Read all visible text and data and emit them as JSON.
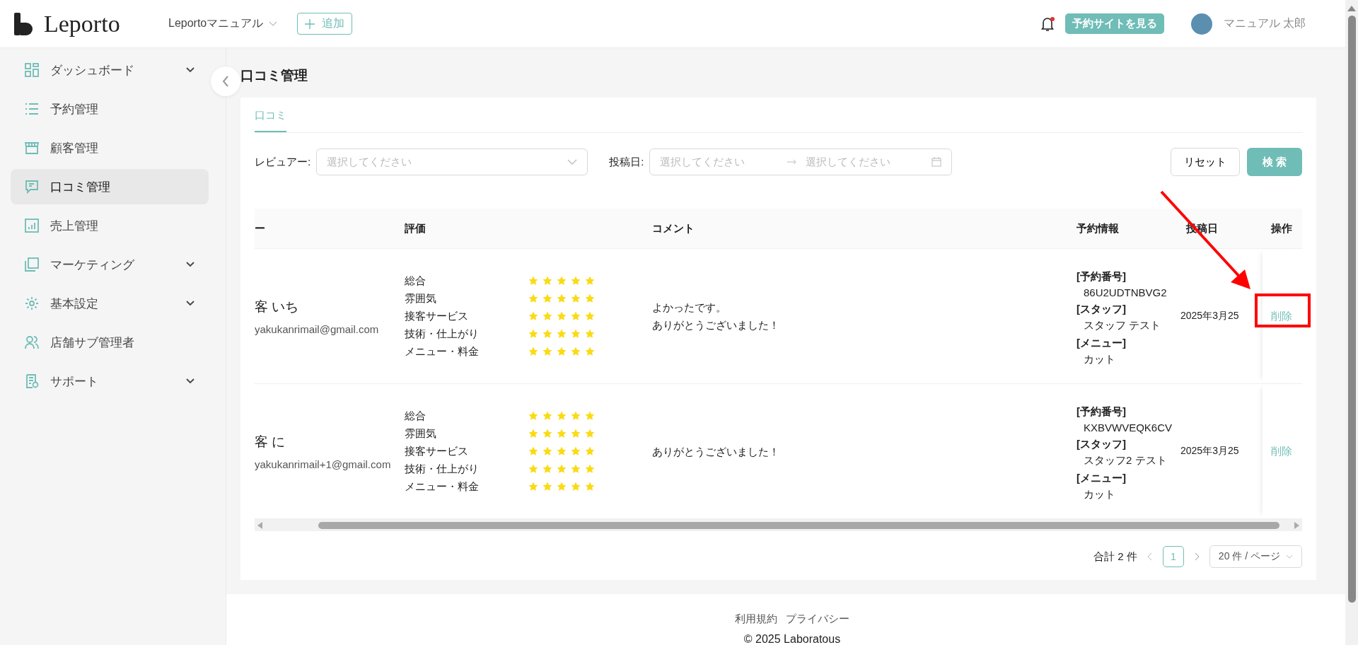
{
  "header": {
    "logo": "Leporto",
    "store_select": "Leportoマニュアル",
    "add_button": "追加",
    "has_notification": true,
    "site_button": "予約サイトを見る",
    "user_name": "マニュアル 太郎"
  },
  "sidebar": {
    "items": [
      {
        "label": "ダッシュボード",
        "expandable": true,
        "selected": false
      },
      {
        "label": "予約管理",
        "expandable": false,
        "selected": false
      },
      {
        "label": "顧客管理",
        "expandable": false,
        "selected": false
      },
      {
        "label": "口コミ管理",
        "expandable": false,
        "selected": true
      },
      {
        "label": "売上管理",
        "expandable": false,
        "selected": false
      },
      {
        "label": "マーケティング",
        "expandable": true,
        "selected": false
      },
      {
        "label": "基本設定",
        "expandable": true,
        "selected": false
      },
      {
        "label": "店舗サブ管理者",
        "expandable": false,
        "selected": false
      },
      {
        "label": "サポート",
        "expandable": true,
        "selected": false
      }
    ]
  },
  "page_title": "口コミ管理",
  "tabs": [
    {
      "label": "口コミ",
      "selected": true
    }
  ],
  "filters": {
    "reviewer_label": "レビュアー:",
    "reviewer_placeholder": "選択してください",
    "date_label": "投稿日:",
    "date_start_placeholder": "選択してください",
    "date_end_placeholder": "選択してください",
    "reset_button": "リセット",
    "search_button": "検 索"
  },
  "table": {
    "columns": [
      "ー",
      "評価",
      "コメント",
      "予約情報",
      "投稿日",
      "操作"
    ],
    "rows": [
      {
        "name": "客 いち",
        "email": "yakukanrimail@gmail.com",
        "ratings": [
          {
            "label": "総合",
            "stars": 5
          },
          {
            "label": "雰囲気",
            "stars": 5
          },
          {
            "label": "接客サービス",
            "stars": 5
          },
          {
            "label": "技術・仕上がり",
            "stars": 5
          },
          {
            "label": "メニュー・料金",
            "stars": 5
          }
        ],
        "comment": [
          "よかったです。",
          "ありがとうございました！"
        ],
        "reservation": [
          {
            "label": "[予約番号]",
            "value": "86U2UDTNBVG2"
          },
          {
            "label": "[スタッフ]",
            "value": "スタッフ テスト"
          },
          {
            "label": "[メニュー]",
            "value": "カット"
          }
        ],
        "date": "2025年3月25",
        "action": "削除"
      },
      {
        "name": "客 に",
        "email": "yakukanrimail+1@gmail.com",
        "ratings": [
          {
            "label": "総合",
            "stars": 5
          },
          {
            "label": "雰囲気",
            "stars": 5
          },
          {
            "label": "接客サービス",
            "stars": 5
          },
          {
            "label": "技術・仕上がり",
            "stars": 5
          },
          {
            "label": "メニュー・料金",
            "stars": 5
          }
        ],
        "comment": [
          "ありがとうございました！"
        ],
        "reservation": [
          {
            "label": "[予約番号]",
            "value": "KXBVWVEQK6CV"
          },
          {
            "label": "[スタッフ]",
            "value": "スタッフ2 テスト"
          },
          {
            "label": "[メニュー]",
            "value": "カット"
          }
        ],
        "date": "2025年3月25",
        "action": "削除"
      }
    ]
  },
  "pagination": {
    "total": "合計 2 件",
    "pages": [
      {
        "label": "1",
        "selected": true
      }
    ],
    "page_size": "20 件 / ページ"
  },
  "footer": {
    "links": [
      "利用規約",
      "プライバシー"
    ],
    "copyright": "© 2025 Laboratous"
  }
}
